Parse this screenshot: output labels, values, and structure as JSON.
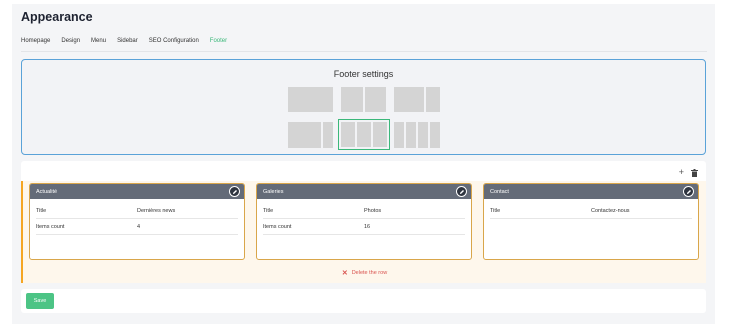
{
  "page": {
    "title": "Appearance"
  },
  "tabs": [
    "Homepage",
    "Design",
    "Menu",
    "Sidebar",
    "SEO Configuration",
    "Footer"
  ],
  "active_tab": "Footer",
  "footer_settings": {
    "title": "Footer settings",
    "layouts": [
      {
        "columns": 1,
        "selected": false
      },
      {
        "columns": 2,
        "selected": false
      },
      {
        "columns": "2 (wide-narrow)",
        "selected": false
      },
      {
        "columns": "2 (wide-narrow)",
        "selected": false
      },
      {
        "columns": 3,
        "selected": true
      },
      {
        "columns": 4,
        "selected": false
      }
    ]
  },
  "row": {
    "add_icon": "plus-icon",
    "delete_icon": "trash-icon",
    "cards": [
      {
        "title": "Actualité",
        "props": [
          {
            "key": "Title",
            "value": "Dernières news"
          },
          {
            "key": "Items count",
            "value": "4"
          }
        ]
      },
      {
        "title": "Galeries",
        "props": [
          {
            "key": "Title",
            "value": "Photos"
          },
          {
            "key": "Items count",
            "value": "16"
          }
        ]
      },
      {
        "title": "Contact",
        "props": [
          {
            "key": "Title",
            "value": "Contactez-nous"
          }
        ]
      }
    ],
    "delete_label": "Delete the row"
  },
  "actions": {
    "save_label": "Save"
  },
  "colors": {
    "accent": "#3bb87a",
    "save": "#4cc485",
    "card_header": "#646b78",
    "row_border": "#f5a623",
    "danger": "#d9534f",
    "settings_border": "#5aa2d8"
  }
}
